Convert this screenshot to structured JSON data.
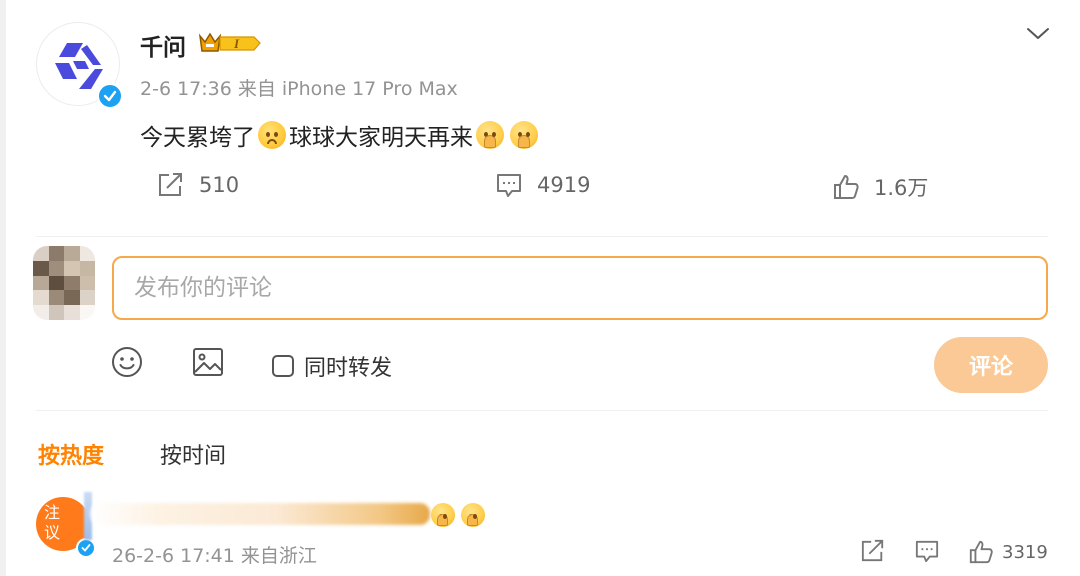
{
  "post": {
    "username": "千问",
    "meta": "2-6 17:36 来自 iPhone 17 Pro Max",
    "text_part1": "今天累垮了",
    "text_part2": "球球大家明天再来",
    "vip_label": "I",
    "emoji_names": [
      "weary-face-emoji",
      "pray-emoji",
      "pray-emoji"
    ]
  },
  "actions": {
    "repost_count": "510",
    "comment_count": "4919",
    "like_count": "1.6万"
  },
  "composer": {
    "placeholder": "发布你的评论",
    "repost_label": "同时转发",
    "submit_label": "评论"
  },
  "sort": {
    "hot_label": "按热度",
    "time_label": "按时间"
  },
  "comment": {
    "avatar_text": "注\n议",
    "meta": "26-2-6 17:41 来自浙江",
    "like_count": "3319"
  },
  "colors": {
    "accent": "#ff8200",
    "input_border": "#f7a84b",
    "submit_bg": "#fbc995",
    "verified": "#1da1f2",
    "brand_blue": "#4a4bdc"
  }
}
